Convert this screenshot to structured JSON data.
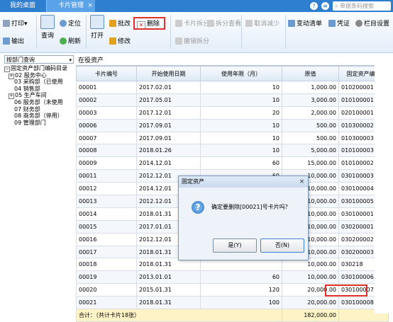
{
  "tabs": {
    "home": "我的桌面",
    "card": "卡片管理",
    "close": "×"
  },
  "top_icons": {
    "help": "?",
    "menu": "≡",
    "search_placeholder": "单据条码搜索"
  },
  "toolbar": {
    "print": "打印",
    "print_caret": "▾",
    "export": "输出",
    "query": "查询",
    "locate": "定位",
    "refresh": "刷新",
    "open": "打开",
    "batch_change": "批改",
    "delete": "删除",
    "modify": "修改",
    "card_split": "卡片拆分",
    "split_view": "拆分查看",
    "undo_split": "撤销拆分",
    "cancel_reduce": "取消减少",
    "change_list": "变动清单",
    "voucher": "凭证",
    "column_settings": "栏目设置"
  },
  "dept_select": {
    "value": "按部门查询",
    "caret": "▾"
  },
  "tree": {
    "root": "固定资产部门编码目录",
    "items": [
      {
        "toggle": "+",
        "label": "02 服务中心"
      },
      {
        "toggle": "",
        "label": "03 采购部（已使用"
      },
      {
        "toggle": "",
        "label": "04 销售部"
      },
      {
        "toggle": "+",
        "label": "05 生产车间"
      },
      {
        "toggle": "",
        "label": "06 服务部（未使用"
      },
      {
        "toggle": "",
        "label": "07 财务部"
      },
      {
        "toggle": "",
        "label": "08 商务部（停用）"
      },
      {
        "toggle": "",
        "label": "09 管理部门"
      }
    ]
  },
  "section_title": "在役资产",
  "table": {
    "headers": [
      "卡片编号",
      "开始使用日期",
      "使用年限（月）",
      "原值",
      "固定资产编号"
    ],
    "rows": [
      [
        "00001",
        "2017.02.01",
        "10",
        "1,000.00",
        "010200001"
      ],
      [
        "00002",
        "2017.05.01",
        "10",
        "3,000.00",
        "010100001"
      ],
      [
        "00003",
        "2017.12.01",
        "20",
        "2,000.00",
        "020100001"
      ],
      [
        "00006",
        "2017.09.01",
        "10",
        "500.00",
        "010300002"
      ],
      [
        "00007",
        "2017.09.01",
        "10",
        "500.00",
        "010300003"
      ],
      [
        "00008",
        "2018.01.26",
        "10",
        "5,000.00",
        "010100003"
      ],
      [
        "00009",
        "2014.12.01",
        "60",
        "15,000.00",
        "010100002"
      ],
      [
        "00011",
        "2012.12.01",
        "60",
        "10,000.00",
        "030100003"
      ],
      [
        "00012",
        "2014.12.01",
        "",
        "10,000.00",
        "030100004"
      ],
      [
        "00013",
        "2012.12.01",
        "",
        "10,000.00",
        "030100005"
      ],
      [
        "00014",
        "2018.01.31",
        "",
        "10,000.00",
        "030100001"
      ],
      [
        "00015",
        "2017.01.01",
        "",
        "10,000.00",
        "030200001"
      ],
      [
        "00016",
        "2012.12.01",
        "",
        "10,000.00",
        "030200002"
      ],
      [
        "00017",
        "2018.01.31",
        "",
        "10,000.00",
        "030200003"
      ],
      [
        "00018",
        "2018.01.31",
        "",
        "10,000.00",
        "030218"
      ],
      [
        "00019",
        "2013.01.01",
        "60",
        "10,000.00",
        "030100006"
      ],
      [
        "00020",
        "2015.01.31",
        "120",
        "20,000.00",
        "030100007"
      ],
      [
        "00021",
        "2018.01.31",
        "100",
        "20,000.00",
        "030100008"
      ]
    ],
    "total_label": "合计：（共计卡片18张）",
    "total_value": "182,000.00"
  },
  "dialog": {
    "title": "固定资产",
    "close": "×",
    "icon": "?",
    "message": "确定要删除[00021]号卡片吗？",
    "yes": "是(Y)",
    "no": "否(N)"
  },
  "colors": {
    "accent": "#2f7fd0",
    "highlight": "#e0302a"
  }
}
